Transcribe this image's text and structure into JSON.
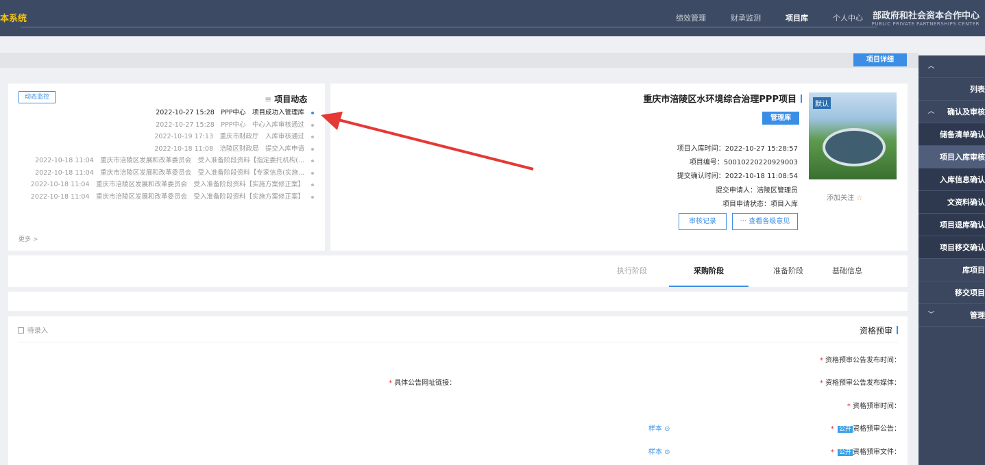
{
  "topbar": {
    "brand_left": "本系统",
    "brand_cn": "部政府和社会资本合作中心",
    "brand_en": "PUBLIC PRIVATE PARTNERSHIPS CENTER",
    "nav": [
      "个人中心",
      "项目库",
      "财承监测",
      "绩效管理"
    ],
    "active_nav": "项目库"
  },
  "sidebar": {
    "items": [
      {
        "label": "",
        "caret": "^",
        "type": "group"
      },
      {
        "label": "列表",
        "type": "item"
      },
      {
        "label": "确认及审核",
        "caret": "^",
        "type": "group"
      },
      {
        "label": "储备清单确认",
        "type": "sub"
      },
      {
        "label": "项目入库审核",
        "type": "sub",
        "active": true
      },
      {
        "label": "入库信息确认",
        "type": "sub"
      },
      {
        "label": "文资料确认",
        "type": "sub"
      },
      {
        "label": "项目退库确认",
        "type": "sub"
      },
      {
        "label": "项目移交确认",
        "type": "sub"
      },
      {
        "label": "库项目",
        "type": "item"
      },
      {
        "label": "移交项目",
        "type": "item"
      },
      {
        "label": "管理",
        "caret": "v",
        "type": "group"
      }
    ]
  },
  "detail_tag": "项目详细",
  "project": {
    "title": "重庆市涪陵区水环境综合治理PPP项目",
    "mgmt_label": "管理库",
    "image_badge": "默认",
    "follow": "添加关注",
    "info": [
      "项目入库时间：2022-10-27 15:28:57",
      "项目编号：50010220220929003",
      "提交确认时间：2022-10-18 11:08:54",
      "提交申请人：涪陵区管理员",
      "项目申请状态：项目入库"
    ],
    "btn_opinions": "··· 查看各级意见",
    "btn_record": "审核记录"
  },
  "dynamics": {
    "title": "项目动态",
    "menu_icon": "≡",
    "monitor": "动态监控",
    "more": "更多 >",
    "rows": [
      "2022-10-27 15:28　PPP中心　项目成功入管理库",
      "2022-10-27 15:28　PPP中心　中心入库审核通过",
      "2022-10-19 17:13　重庆市财政厅　入库审核通过",
      "2022-10-18 11:08　涪陵区财政局　提交入库申请",
      "2022-10-18 11:04　重庆市涪陵区发展和改革委员会　受入准备阶段资料【指定委托机构(...",
      "2022-10-18 11:04　重庆市涪陵区发展和改革委员会　受入准备阶段资料【专家信息(实施...",
      "2022-10-18 11:04　重庆市涪陵区发展和改革委员会　受入准备阶段资料【实施方案修正案】",
      "2022-10-18 11:04　重庆市涪陵区发展和改革委员会　受入准备阶段资料【实施方案修正案】"
    ]
  },
  "tabs": [
    "基础信息",
    "准备阶段",
    "采购阶段",
    "执行阶段"
  ],
  "active_tab": "采购阶段",
  "qualification": {
    "title": "资格预审",
    "pending": "待录入",
    "fields": {
      "publish_time": "资格预审公告发布时间：",
      "media": "资格预审公告发布媒体：",
      "link": "具体公告网址链接：",
      "review_time": "资格预审时间：",
      "notice": "资格预审公告：",
      "doc": "资格预审文件："
    },
    "public_tag": "公开",
    "sample": "样本 ⊙"
  },
  "colors": {
    "accent": "#3a8ee6",
    "topbar": "#3d4a63",
    "sidebar": "#3b475f",
    "arrow": "#e53935"
  }
}
